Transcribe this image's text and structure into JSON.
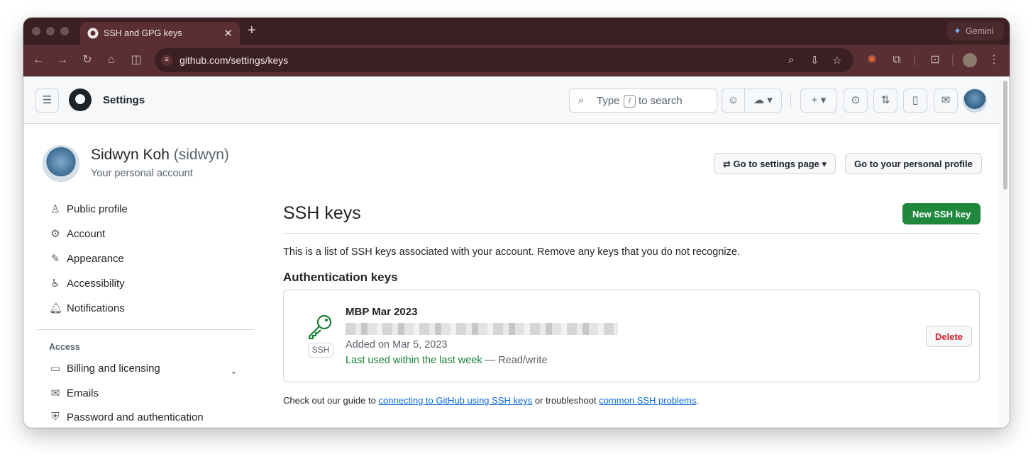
{
  "browser": {
    "tab_title": "SSH and GPG keys",
    "tab_close": "✕",
    "new_tab": "+",
    "gemini_label": "Gemini",
    "url": "github.com/settings/keys"
  },
  "header": {
    "title": "Settings",
    "search_prefix": "Type",
    "search_key": "/",
    "search_suffix": "to search"
  },
  "profile": {
    "name": "Sidwyn Koh",
    "handle": "(sidwyn)",
    "subtitle": "Your personal account",
    "go_settings_label": "Go to settings page",
    "go_profile_label": "Go to your personal profile"
  },
  "sidebar": {
    "items": [
      {
        "label": "Public profile",
        "icon": "person-icon"
      },
      {
        "label": "Account",
        "icon": "gear-icon"
      },
      {
        "label": "Appearance",
        "icon": "paintbrush-icon"
      },
      {
        "label": "Accessibility",
        "icon": "accessibility-icon"
      },
      {
        "label": "Notifications",
        "icon": "bell-icon"
      }
    ],
    "access_heading": "Access",
    "access_items": [
      {
        "label": "Billing and licensing",
        "icon": "credit-card-icon"
      },
      {
        "label": "Emails",
        "icon": "mail-icon"
      },
      {
        "label": "Password and authentication",
        "icon": "shield-lock-icon"
      }
    ]
  },
  "main": {
    "title": "SSH keys",
    "new_key_label": "New SSH key",
    "description": "This is a list of SSH keys associated with your account. Remove any keys that you do not recognize.",
    "section_heading": "Authentication keys",
    "key": {
      "badge": "SSH",
      "title": "MBP Mar 2023",
      "added": "Added on Mar 5, 2023",
      "last_used": "Last used within the last week",
      "access": "— Read/write",
      "delete_label": "Delete"
    },
    "guide": {
      "prefix": "Check out our guide to",
      "link1": "connecting to GitHub using SSH keys",
      "middle": "or troubleshoot",
      "link2": "common SSH problems",
      "suffix": "."
    }
  },
  "colors": {
    "primary_button": "#1f883d",
    "danger_text": "#d1242f",
    "link": "#0969da",
    "browser_frame": "#5a2f33"
  }
}
